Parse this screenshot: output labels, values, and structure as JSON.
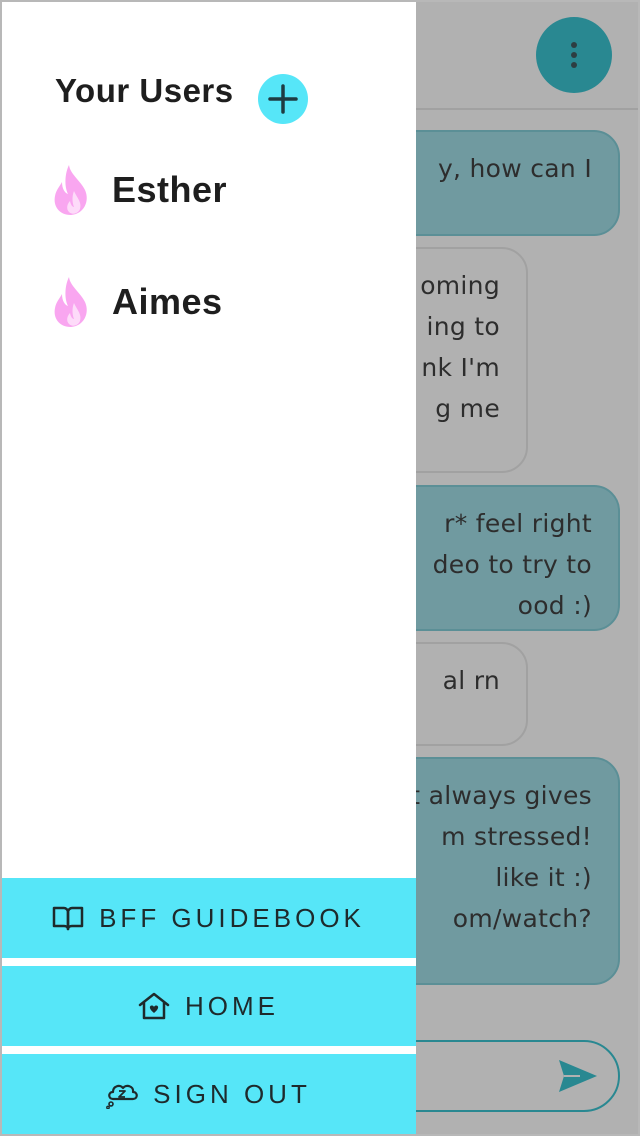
{
  "chat": {
    "messages": [
      {
        "from": "bot",
        "lines": [
          "y, how can I",
          ""
        ]
      },
      {
        "from": "user",
        "lines": [
          "oming",
          "ing to",
          "nk I'm",
          "g me",
          ""
        ]
      },
      {
        "from": "bot",
        "lines": [
          "r* feel right",
          "deo to try to",
          "ood :)"
        ]
      },
      {
        "from": "user",
        "lines": [
          "al rn",
          ""
        ]
      },
      {
        "from": "bot",
        "lines": [
          "t always gives",
          "m stressed!",
          "like it :)",
          "om/watch?",
          ""
        ]
      }
    ]
  },
  "drawer": {
    "title": "Your Users",
    "users": [
      {
        "name": "Esther"
      },
      {
        "name": "Aimes"
      }
    ],
    "menu": {
      "guidebook": "BFF GUIDEBOOK",
      "home": "HOME",
      "signout": "SIGN OUT"
    }
  },
  "colors": {
    "accent": "#56e6f8",
    "teal": "#16b8c9",
    "flame": "#f9a6f0"
  },
  "icons": [
    "more-vertical-icon",
    "plus-icon",
    "flame-icon",
    "book-icon",
    "home-heart-icon",
    "sleep-cloud-icon",
    "send-icon"
  ]
}
